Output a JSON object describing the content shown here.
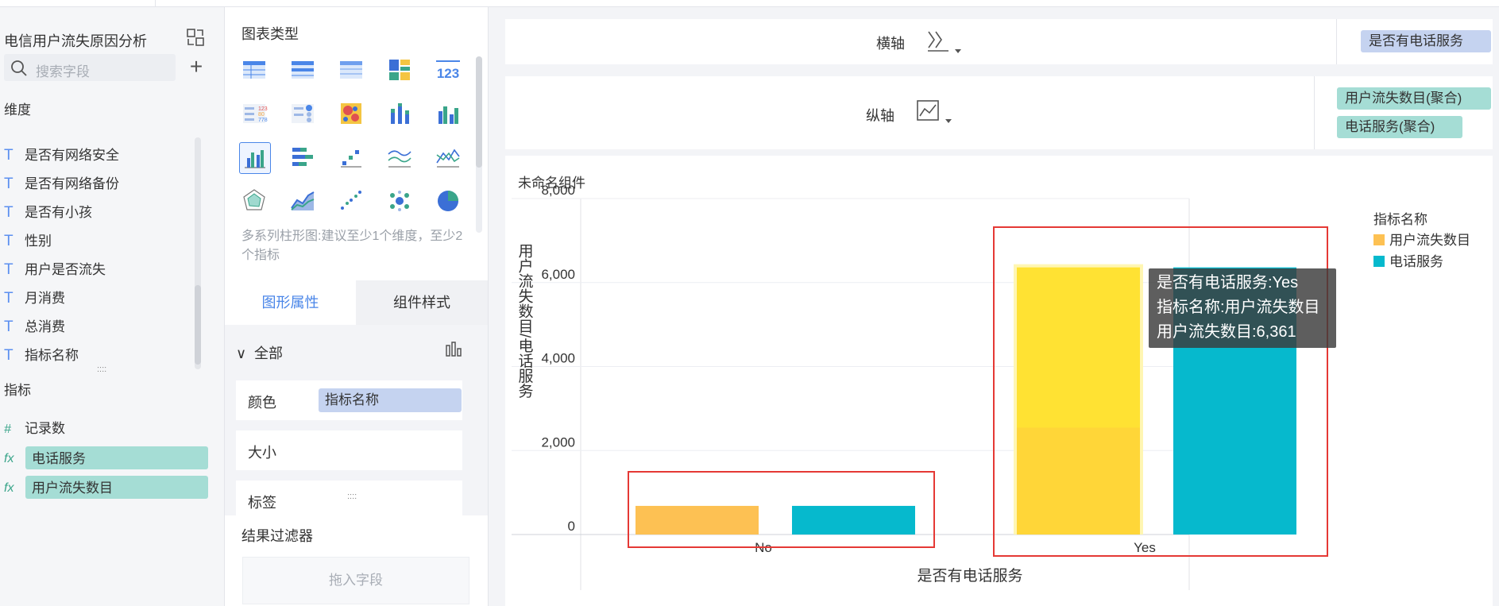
{
  "left_panel": {
    "title": "电信用户流失原因分析",
    "search_placeholder": "搜索字段",
    "dimensions_label": "维度",
    "dimensions": [
      "是否有网络安全",
      "是否有网络备份",
      "是否有小孩",
      "性别",
      "用户是否流失",
      "月消费",
      "总消费",
      "指标名称"
    ],
    "measures_label": "指标",
    "measures": [
      {
        "name": "记录数",
        "highlighted": false
      },
      {
        "name": "电话服务",
        "highlighted": true
      },
      {
        "name": "用户流失数目",
        "highlighted": true
      }
    ]
  },
  "middle_panel": {
    "heading": "图表类型",
    "hint": "多系列柱形图:建议至少1个维度，至少2个指标",
    "tabs": [
      "图形属性",
      "组件样式"
    ],
    "all_label": "全部",
    "props": [
      {
        "label": "颜色",
        "value": "指标名称"
      },
      {
        "label": "大小",
        "value": ""
      },
      {
        "label": "标签",
        "value": ""
      }
    ],
    "filter_label": "结果过滤器",
    "drop_placeholder": "拖入字段"
  },
  "x_axis_bar": {
    "label": "横轴",
    "fields": [
      "是否有电话服务"
    ]
  },
  "y_axis_bar": {
    "label": "纵轴",
    "fields": [
      "用户流失数目(聚合)",
      "电话服务(聚合)"
    ]
  },
  "component": {
    "title": "未命名组件"
  },
  "chart_data": {
    "type": "bar",
    "title": "",
    "xlabel": "是否有电话服务",
    "ylabel": "用户流失数目/电话服务",
    "categories": [
      "No",
      "Yes"
    ],
    "ylim": [
      0,
      8000
    ],
    "yticks": [
      0,
      2000,
      4000,
      6000,
      8000
    ],
    "ytick_labels": [
      "0",
      "2,000",
      "4,000",
      "6,000",
      "8,000"
    ],
    "legend_title": "指标名称",
    "legend_position": "right",
    "series": [
      {
        "name": "用户流失数目",
        "color": "#fdc153",
        "values": [
          682,
          6361
        ]
      },
      {
        "name": "电话服务",
        "color": "#06b9cd",
        "values": [
          682,
          6361
        ]
      }
    ],
    "tooltip": {
      "lines": [
        "是否有电话服务:Yes",
        "指标名称:用户流失数目",
        "用户流失数目:6,361"
      ]
    },
    "highlight_color": "#e53935"
  }
}
